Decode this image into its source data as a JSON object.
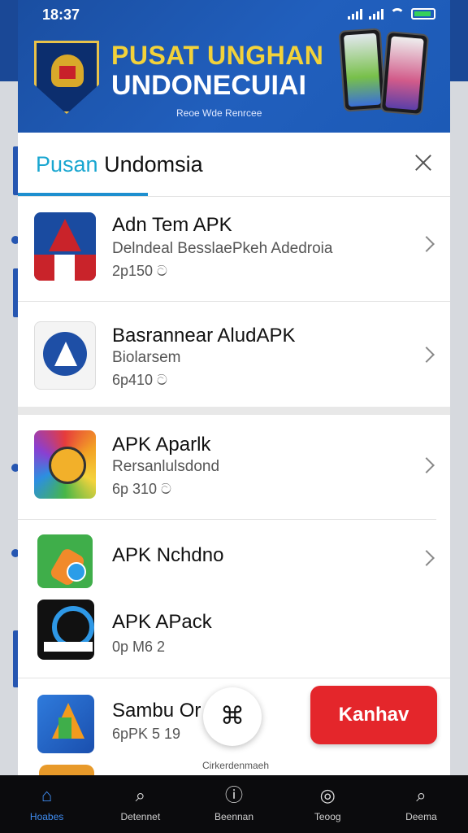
{
  "status_bar": {
    "time": "18:37"
  },
  "banner": {
    "title_line1": "PUSAT UNGHAN",
    "title_line2": "UNDONECUIAI",
    "subtitle": "Reoe Wde Renrcee"
  },
  "sheet": {
    "title_accent": "Pusan",
    "title_rest": " Undomsia",
    "items": [
      {
        "title": "Adn Tem APK",
        "subtitle": "Delndeal BesslaePkeh Adedroia",
        "meta": "2p150  ට"
      },
      {
        "title": "Basrannear AludAPK",
        "subtitle": "Biolarsem",
        "meta": "6p410  ට"
      },
      {
        "title": "APK Aparlk",
        "subtitle": "Rersanlulsdond",
        "meta": "6p 310  ට"
      },
      {
        "title": "APK Nchdno",
        "subtitle": "",
        "meta": ""
      },
      {
        "title": "APK APack",
        "subtitle": "",
        "meta": "0p M6  2"
      },
      {
        "title": "Sambu Or",
        "subtitle": "",
        "meta": "6pPK 5 19"
      }
    ]
  },
  "fab": {
    "icon": "share-network-icon",
    "glyph": "⌘",
    "label": "Cirkerdenmaeh"
  },
  "cta": {
    "label": "Kanhav",
    "color": "#e4262b"
  },
  "bottom_nav": {
    "items": [
      {
        "label": "Hoabes",
        "icon": "home-icon",
        "glyph": "⌂",
        "active": true
      },
      {
        "label": "Detennet",
        "icon": "search-icon",
        "glyph": "⌕",
        "active": false
      },
      {
        "label": "Beennan",
        "icon": "info-icon",
        "glyph": "ⓘ",
        "active": false
      },
      {
        "label": "Teoog",
        "icon": "compass-icon",
        "glyph": "◎",
        "active": false
      },
      {
        "label": "Deema",
        "icon": "search-icon",
        "glyph": "⌕",
        "active": false
      }
    ]
  },
  "colors": {
    "accent": "#19a6d0",
    "nav_active": "#3f8cf0",
    "banner_bg": "#1a4ea1",
    "banner_title": "#f2d23a"
  }
}
